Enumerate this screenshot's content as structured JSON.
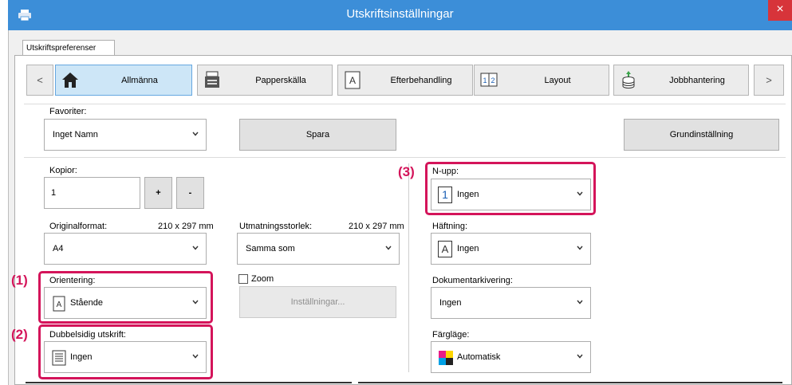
{
  "window": {
    "title": "Utskriftsinställningar",
    "close_glyph": "×"
  },
  "tabs": [
    {
      "label": "Utskriftspreferenser"
    }
  ],
  "categories": {
    "prev_glyph": "<",
    "next_glyph": ">",
    "items": [
      {
        "label": "Allmänna",
        "icon": "home-icon"
      },
      {
        "label": "Papperskälla",
        "icon": "paper-tray-icon"
      },
      {
        "label": "Efterbehandling",
        "icon": "finishing-icon"
      },
      {
        "label": "Layout",
        "icon": "layout-icon"
      },
      {
        "label": "Jobbhantering",
        "icon": "job-handling-icon"
      }
    ]
  },
  "favorites": {
    "label": "Favoriter:",
    "value": "Inget Namn",
    "save_label": "Spara",
    "default_label": "Grundinställning"
  },
  "copies": {
    "label": "Kopior:",
    "value": "1",
    "plus": "+",
    "minus": "-"
  },
  "original_size": {
    "label": "Originalformat:",
    "dims": "210 x 297 mm",
    "value": "A4"
  },
  "output_size": {
    "label": "Utmatningsstorlek:",
    "dims": "210 x 297 mm",
    "value": "Samma som"
  },
  "orientation": {
    "label": "Orientering:",
    "value": "Stående"
  },
  "zoom": {
    "label": "Zoom",
    "settings_label": "Inställningar..."
  },
  "duplex": {
    "label": "Dubbelsidig utskrift:",
    "value": "Ingen"
  },
  "n_up": {
    "label": "N-upp:",
    "value": "Ingen",
    "icon_glyph": "1"
  },
  "stapling": {
    "label": "Häftning:",
    "value": "Ingen",
    "icon_glyph": "A"
  },
  "doc_filing": {
    "label": "Dokumentarkivering:",
    "value": "Ingen"
  },
  "color_mode": {
    "label": "Färgläge:",
    "value": "Automatisk"
  },
  "callouts": {
    "one": "(1)",
    "two": "(2)",
    "three": "(3)"
  },
  "colors": {
    "accent": "#3c8ed8",
    "highlight": "#d4145a",
    "active_tab": "#cde6f7"
  }
}
